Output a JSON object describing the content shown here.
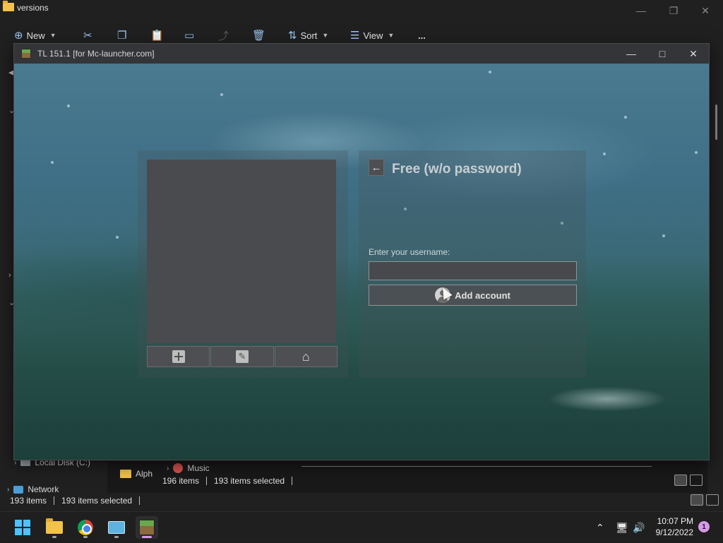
{
  "explorer": {
    "title": "versions",
    "toolbar": {
      "new_label": "New",
      "sort_label": "Sort",
      "view_label": "View",
      "more_label": "..."
    },
    "sidebar": {
      "local_disk": "Local Disk (C:)",
      "network": "Network"
    },
    "inner": {
      "folder_item": "Alph",
      "music_item": "Music",
      "items_count": "196 items",
      "selected_count": "193 items selected"
    },
    "status": {
      "items_count": "193 items",
      "selected_count": "193 items selected"
    }
  },
  "launcher": {
    "title": "TL 151.1 [for Mc-launcher.com]",
    "add_account": {
      "heading": "Free (w/o password)",
      "username_label": "Enter your username:",
      "username_value": "",
      "add_button_label": "Add account"
    }
  },
  "taskbar": {
    "apps": [
      "start",
      "file-explorer",
      "chrome",
      "control-panel",
      "minecraft-launcher"
    ],
    "clock_time": "10:07 PM",
    "clock_date": "9/12/2022",
    "notification_count": "1"
  },
  "colors": {
    "accent_taskbar": "#d69ae8",
    "windows_blue": "#4cc2ff",
    "launcher_panel": "#4a4b4f"
  }
}
